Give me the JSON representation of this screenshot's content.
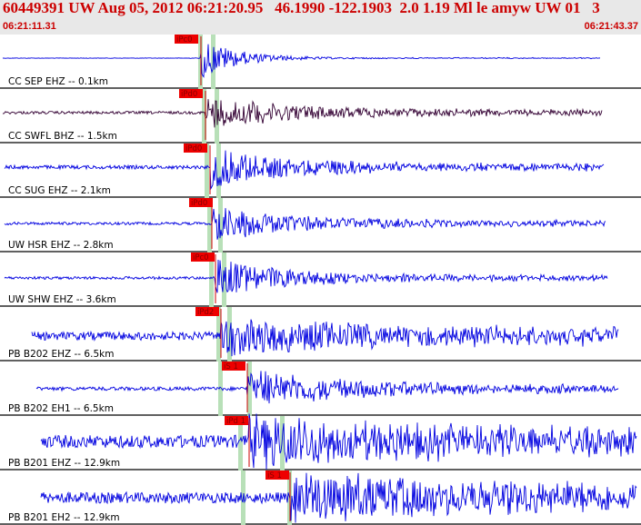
{
  "header": {
    "title": "60449391 UW Aug 05, 2012 06:21:20.95   46.1990 -122.1903  2.0 1.19 Ml le amyw UW 01   3",
    "start_time": "06:21:11.31",
    "end_time": "06:21:43.37"
  },
  "colors": {
    "trace": "#0000e0",
    "trace_alt": "#330033",
    "pick_marker": "#ee0000",
    "pick_window": "#b8e0b8",
    "header_text": "#cc0000"
  },
  "traces": [
    {
      "label": "CC SEP EHZ -- 0.1km",
      "pick": "iPc0",
      "pick2": null
    },
    {
      "label": "CC SWFL BHZ -- 1.5km",
      "pick": "iPd0",
      "pick2": null
    },
    {
      "label": "CC SUG EHZ -- 2.1km",
      "pick": "iPd0",
      "pick2": null
    },
    {
      "label": "UW HSR EHZ -- 2.8km",
      "pick": "iPd0",
      "pick2": null
    },
    {
      "label": "UW SHW EHZ -- 3.6km",
      "pick": "iPc0",
      "pick2": null
    },
    {
      "label": "PB B202 EHZ -- 6.5km",
      "pick": "iPd2",
      "pick2": null
    },
    {
      "label": "PB B202 EH1 -- 6.5km",
      "pick": "iS 1",
      "pick2": null
    },
    {
      "label": "PB B201 EHZ -- 12.9km",
      "pick": "iPd 1",
      "pick2": null
    },
    {
      "label": "PB B201 EH2 -- 12.9km",
      "pick": "iS 1",
      "pick2": null
    }
  ]
}
